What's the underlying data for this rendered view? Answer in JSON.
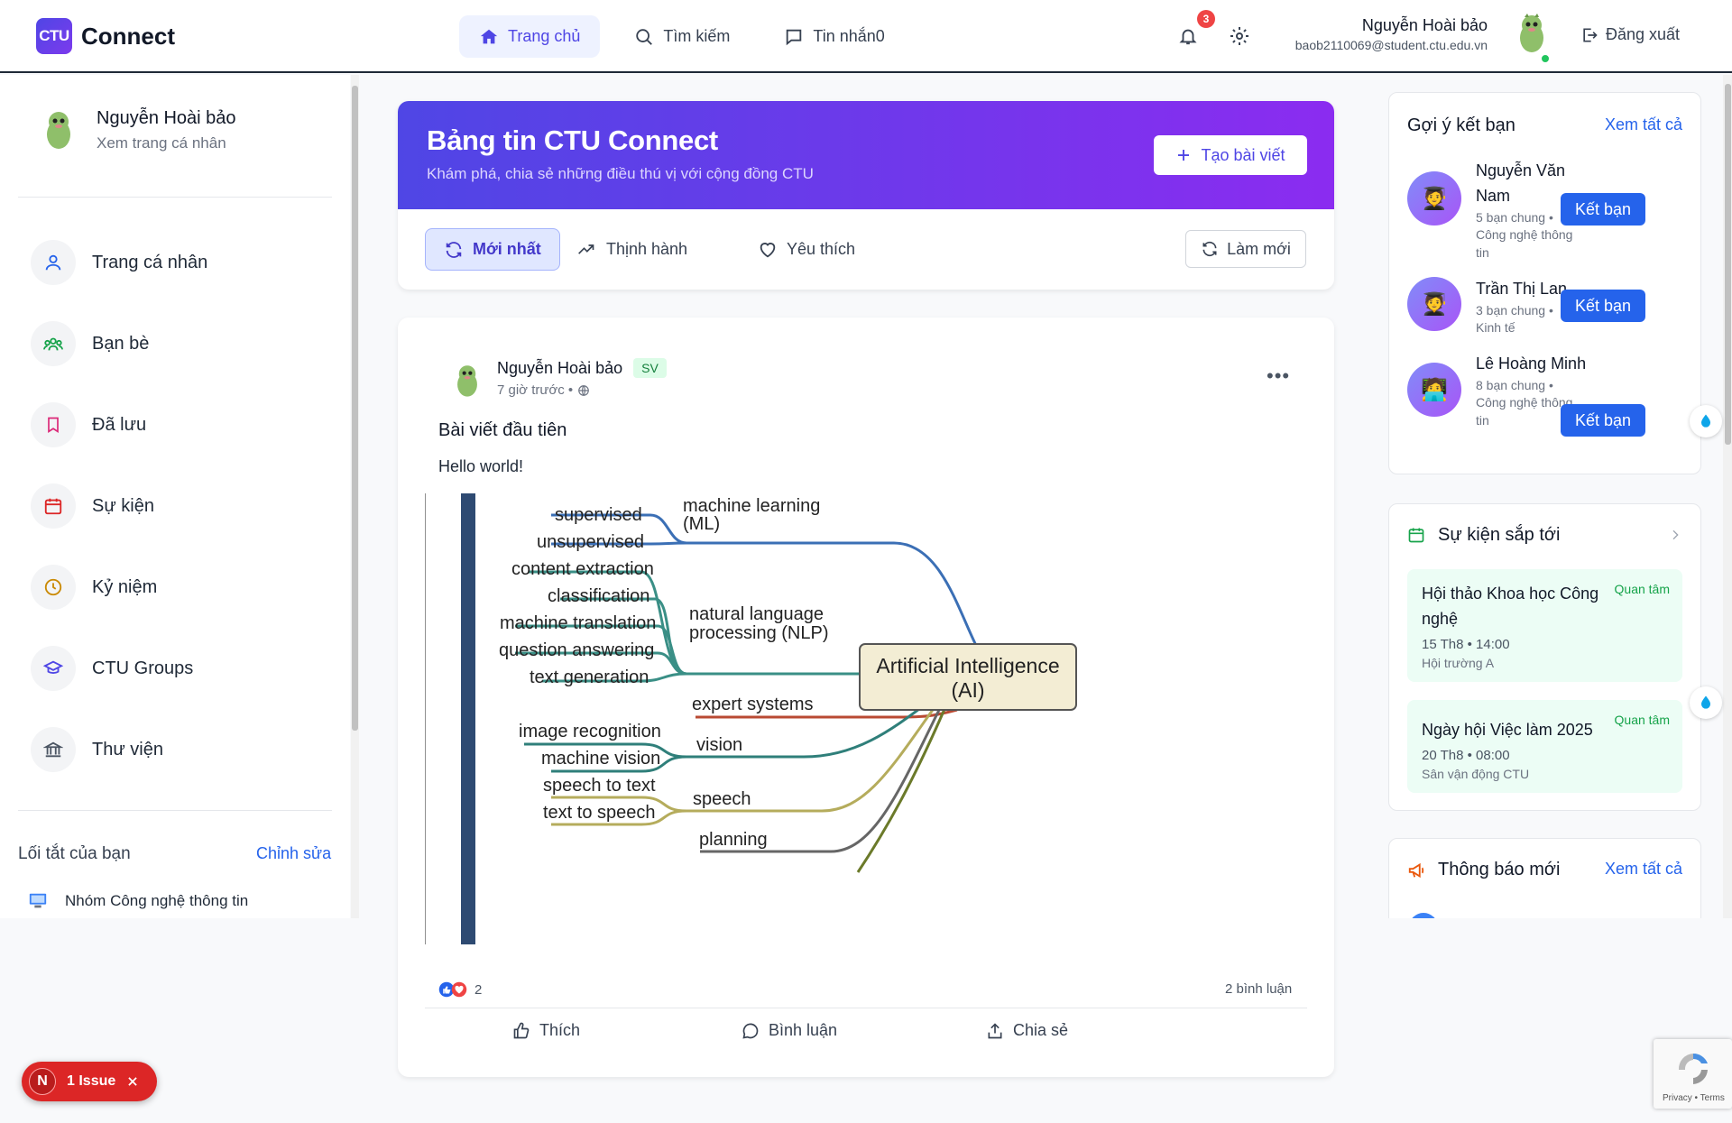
{
  "app": {
    "logo_short": "CTU",
    "logo_name": "Connect"
  },
  "nav": [
    {
      "label": "Trang chủ",
      "active": true,
      "icon": "home-icon"
    },
    {
      "label": "Tìm kiếm",
      "active": false,
      "icon": "search-icon"
    },
    {
      "label": "Tin nhắn0",
      "active": false,
      "icon": "chat-icon"
    }
  ],
  "header": {
    "notification_count": "3",
    "user_name": "Nguyễn Hoài bảo",
    "user_email": "baob2110069@student.ctu.edu.vn",
    "logout_label": "Đăng xuất"
  },
  "sidebar": {
    "profile_name": "Nguyễn Hoài bảo",
    "profile_sub": "Xem trang cá nhân",
    "items": [
      {
        "label": "Trang cá nhân",
        "icon": "user-icon",
        "color": "#2563eb"
      },
      {
        "label": "Bạn bè",
        "icon": "friends-icon",
        "color": "#16a34a"
      },
      {
        "label": "Đã lưu",
        "icon": "bookmark-icon",
        "color": "#db2777"
      },
      {
        "label": "Sự kiện",
        "icon": "calendar-icon",
        "color": "#dc2626"
      },
      {
        "label": "Kỷ niệm",
        "icon": "clock-icon",
        "color": "#ca8a04"
      },
      {
        "label": "CTU Groups",
        "icon": "graduation-cap-icon",
        "color": "#4f46e5"
      },
      {
        "label": "Thư viện",
        "icon": "library-icon",
        "color": "#4b5563"
      }
    ],
    "shortcuts_title": "Lối tắt của bạn",
    "shortcuts_edit": "Chỉnh sửa",
    "shortcuts": [
      {
        "label": "Nhóm Công nghệ thông tin",
        "icon": "computer-icon"
      }
    ]
  },
  "feed": {
    "title": "Bảng tin CTU Connect",
    "subtitle": "Khám phá, chia sẻ những điều thú vị với cộng đồng CTU",
    "create_label": "Tạo bài viết",
    "tabs": [
      {
        "label": "Mới nhất",
        "active": true,
        "icon": "refresh-icon"
      },
      {
        "label": "Thịnh hành",
        "active": false,
        "icon": "trending-icon"
      },
      {
        "label": "Yêu thích",
        "active": false,
        "icon": "heart-icon"
      }
    ],
    "refresh_label": "Làm mới"
  },
  "post": {
    "author": "Nguyễn Hoài bảo",
    "role_tag": "SV",
    "time": "7 giờ trước •",
    "title": "Bài viết đầu tiên",
    "body": "Hello world!",
    "reaction_count": "2",
    "comment_count": "2 bình luận",
    "actions": [
      "Thích",
      "Bình luận",
      "Chia sẻ"
    ],
    "image": {
      "center": [
        "Artificial Intelligence",
        "(AI)"
      ],
      "branches": [
        {
          "name": "machine learning (ML)",
          "color": "#3b6fb5",
          "leaves": [
            "supervised",
            "unsupervised"
          ]
        },
        {
          "name": "natural language processing (NLP)",
          "color": "#3a8f86",
          "leaves": [
            "content extraction",
            "classification",
            "machine translation",
            "question answering",
            "text generation"
          ]
        },
        {
          "name": "expert systems",
          "color": "#b94a33",
          "leaves": []
        },
        {
          "name": "vision",
          "color": "#2f7f7a",
          "leaves": [
            "image recognition",
            "machine vision"
          ]
        },
        {
          "name": "speech",
          "color": "#b5ac5c",
          "leaves": [
            "speech to text",
            "text to speech"
          ]
        },
        {
          "name": "planning",
          "color": "#666666",
          "leaves": []
        }
      ]
    }
  },
  "right": {
    "suggest_title": "Gợi ý kết bạn",
    "see_all": "Xem tất cả",
    "add_label": "Kết bạn",
    "suggestions": [
      {
        "name": "Nguyễn Văn Nam",
        "mutual": "5 bạn chung •",
        "major": "Công nghệ thông tin"
      },
      {
        "name": "Trần Thị Lan",
        "mutual": "3 bạn chung •",
        "major": "Kinh tế"
      },
      {
        "name": "Lê Hoàng Minh",
        "mutual": "8 bạn chung •",
        "major": "Công nghệ thông tin"
      }
    ],
    "events_title": "Sự kiện sắp tới",
    "interest_label": "Quan tâm",
    "events": [
      {
        "title": "Hội thảo Khoa học Công nghệ",
        "date": "15 Th8 • 14:00",
        "place": "Hội trường A"
      },
      {
        "title": "Ngày hội Việc làm 2025",
        "date": "20 Th8 • 08:00",
        "place": "Sân vận động CTU"
      }
    ],
    "notif_title": "Thông báo mới",
    "notif_see_all": "Xem tất cả"
  },
  "overlay": {
    "issue_label": "1 Issue",
    "issue_letter": "N",
    "recaptcha_text": "Privacy • Terms"
  }
}
